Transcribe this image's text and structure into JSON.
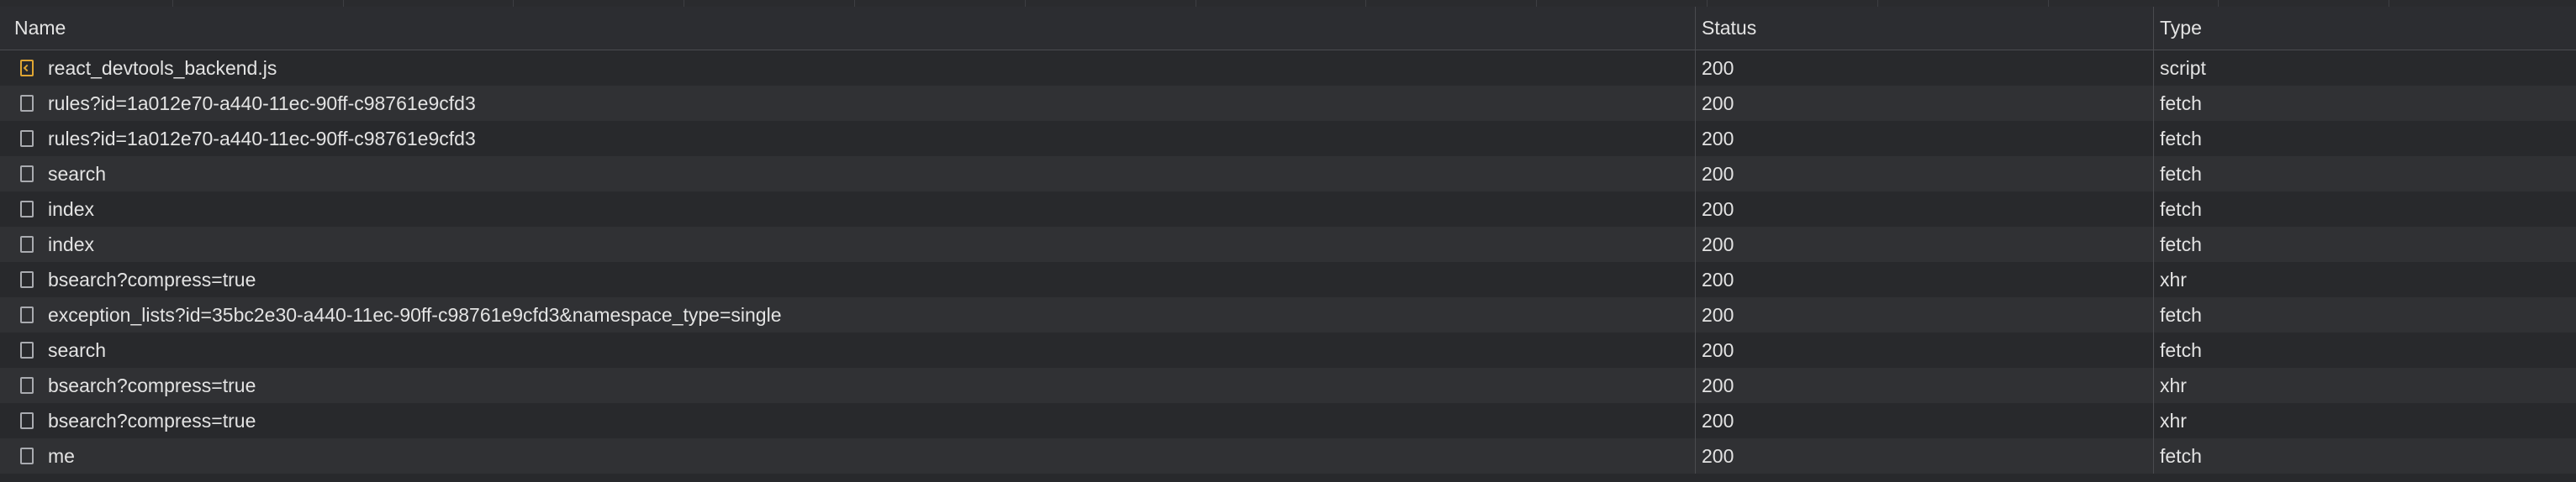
{
  "columns": {
    "name": "Name",
    "status": "Status",
    "type": "Type"
  },
  "requests": [
    {
      "name": "react_devtools_backend.js",
      "status": "200",
      "type": "script",
      "icon": "script-file-icon"
    },
    {
      "name": "rules?id=1a012e70-a440-11ec-90ff-c98761e9cfd3",
      "status": "200",
      "type": "fetch",
      "icon": "document-icon"
    },
    {
      "name": "rules?id=1a012e70-a440-11ec-90ff-c98761e9cfd3",
      "status": "200",
      "type": "fetch",
      "icon": "document-icon"
    },
    {
      "name": "search",
      "status": "200",
      "type": "fetch",
      "icon": "document-icon"
    },
    {
      "name": "index",
      "status": "200",
      "type": "fetch",
      "icon": "document-icon"
    },
    {
      "name": "index",
      "status": "200",
      "type": "fetch",
      "icon": "document-icon"
    },
    {
      "name": "bsearch?compress=true",
      "status": "200",
      "type": "xhr",
      "icon": "document-icon"
    },
    {
      "name": "exception_lists?id=35bc2e30-a440-11ec-90ff-c98761e9cfd3&namespace_type=single",
      "status": "200",
      "type": "fetch",
      "icon": "document-icon"
    },
    {
      "name": "search",
      "status": "200",
      "type": "fetch",
      "icon": "document-icon"
    },
    {
      "name": "bsearch?compress=true",
      "status": "200",
      "type": "xhr",
      "icon": "document-icon"
    },
    {
      "name": "bsearch?compress=true",
      "status": "200",
      "type": "xhr",
      "icon": "document-icon"
    },
    {
      "name": "me",
      "status": "200",
      "type": "fetch",
      "icon": "document-icon"
    }
  ]
}
